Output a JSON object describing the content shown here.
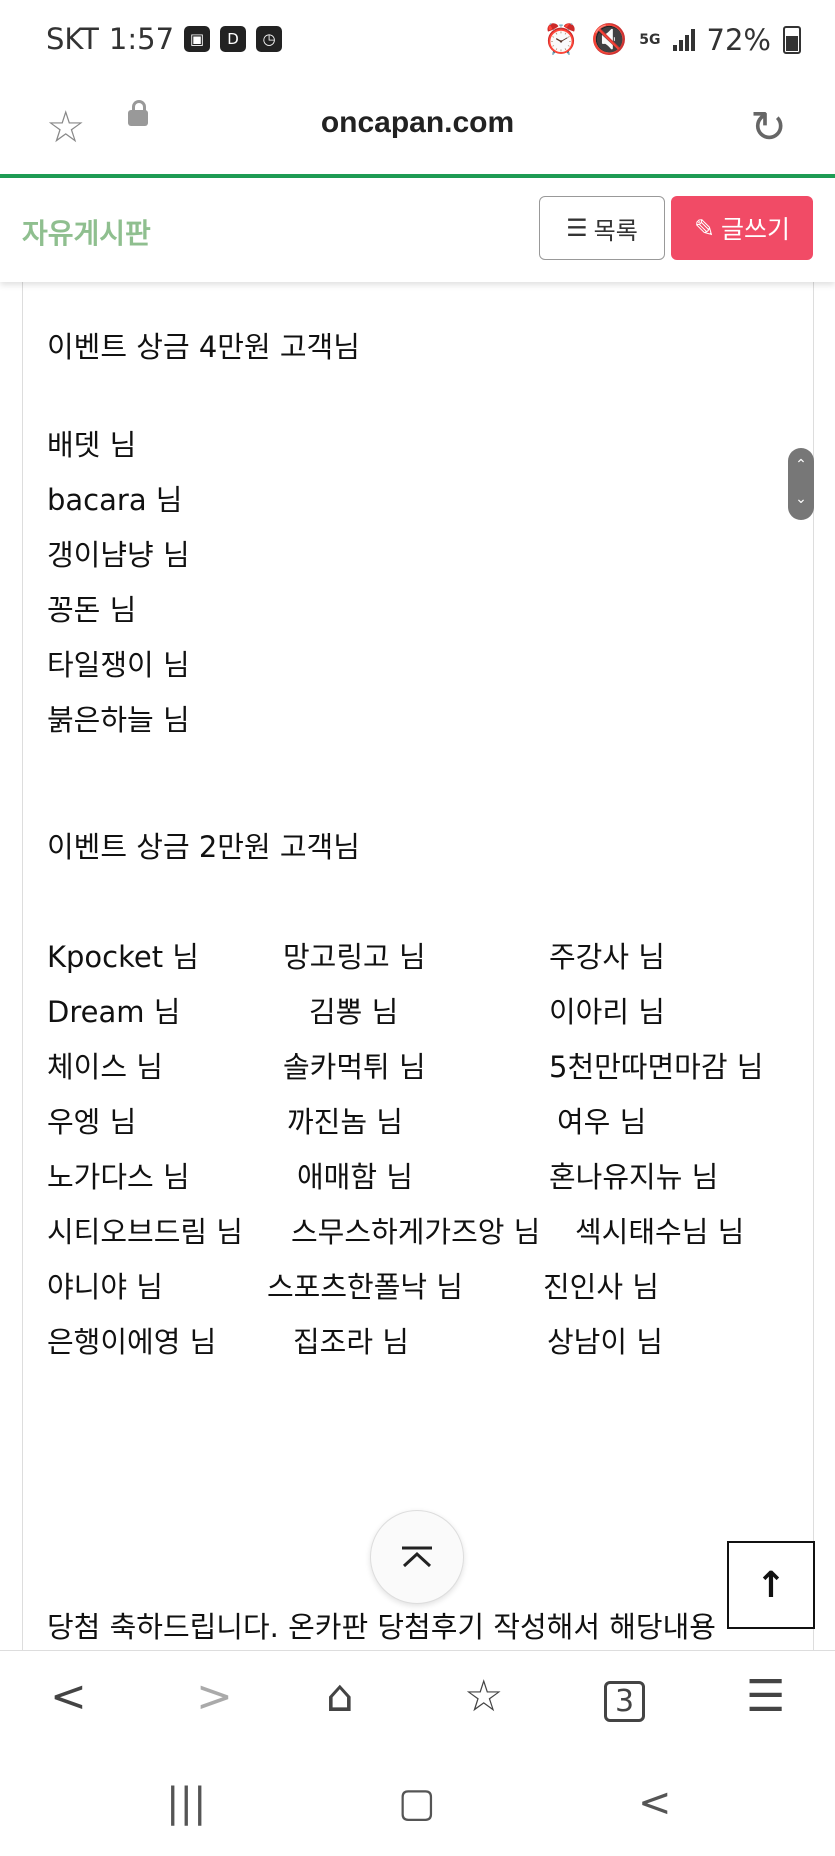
{
  "status_bar": {
    "carrier": "SKT",
    "time": "1:57",
    "icons_left": [
      "gallery-icon",
      "d-app-icon",
      "clock-app-icon"
    ],
    "network": "5G",
    "battery": "72%"
  },
  "url_bar": {
    "url": "oncapan.com"
  },
  "board": {
    "title": "자유게시판",
    "list_button": "목록",
    "write_button": "글쓰기"
  },
  "post": {
    "section_4": "이벤트 상금  4만원 고객님",
    "winners_4": [
      "배뎃 님",
      "bacara 님",
      "갱이냠냥 님",
      "꽁돈 님",
      "타일쟁이 님",
      "붉은하늘 님"
    ],
    "section_2": "이벤트 상금  2만원 고객님",
    "winners_2_rows": [
      [
        "Kpocket 님",
        "망고링고 님",
        "주강사 님"
      ],
      [
        "Dream 님",
        "김뽕 님",
        "이아리 님"
      ],
      [
        "체이스 님",
        "솔카먹튀 님",
        "5천만따면마감 님"
      ],
      [
        "우엥 님",
        "까진놈 님",
        "여우 님"
      ],
      [
        "노가다스 님",
        "애매함 님",
        "혼나유지뉴 님"
      ],
      [
        "시티오브드림 님",
        "스무스하게가즈앙 님",
        "섹시태수님 님"
      ],
      [
        "야니야 님",
        "스포츠한폴낙 님",
        "진인사 님"
      ],
      [
        "은행이에영 님",
        "집조라 님",
        "상남이 님"
      ]
    ],
    "closing": "당첨 축하드립니다. 온카판 당첨후기 작성해서 해당내용"
  }
}
